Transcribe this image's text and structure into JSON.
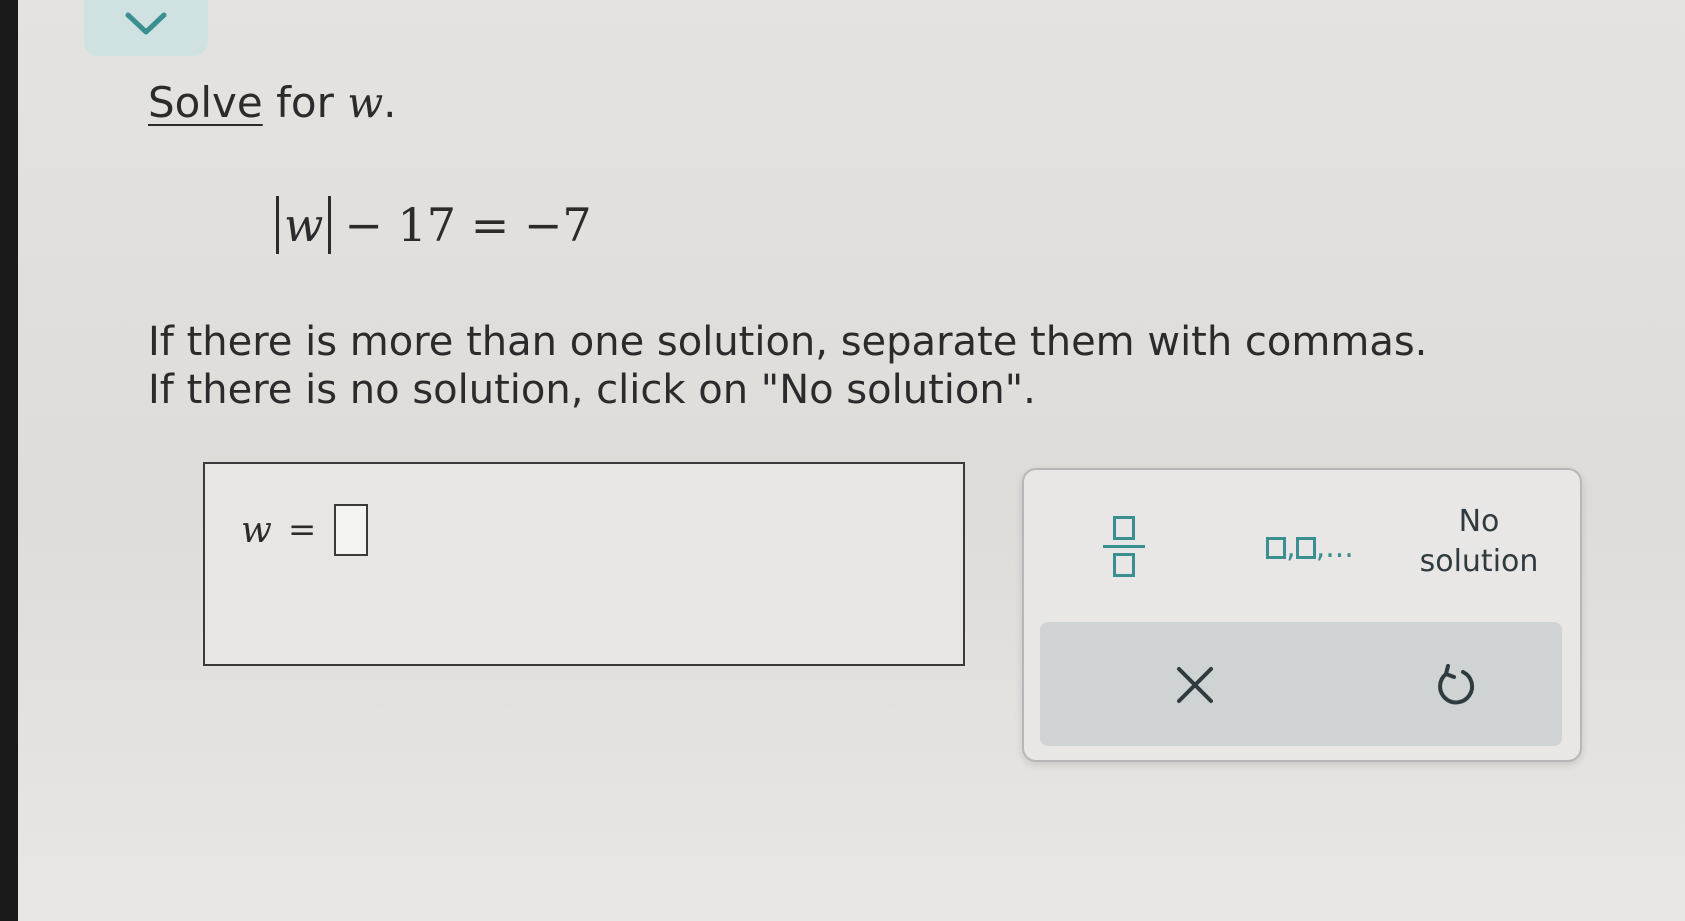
{
  "header": {
    "collapse_icon": "chevron-down-icon"
  },
  "question": {
    "solve_link": "Solve",
    "prompt_middle": " for ",
    "variable": "w",
    "prompt_end": "."
  },
  "equation": {
    "variable": "w",
    "rest": "− 17 = −7"
  },
  "instructions": {
    "line1": "If there is more than one solution, separate them with commas.",
    "line2": "If there is no solution, click on \"No solution\"."
  },
  "answer": {
    "variable": "w",
    "equals": "=",
    "value": ""
  },
  "keypad": {
    "fraction_icon": "fraction-icon",
    "list_icon": "comma-list-icon",
    "list_sep_1": ",",
    "list_sep_2": ",...",
    "no_solution_line1": "No",
    "no_solution_line2": "solution",
    "clear_icon": "close-icon",
    "undo_icon": "undo-icon",
    "accent_color": "#3a8f91"
  }
}
